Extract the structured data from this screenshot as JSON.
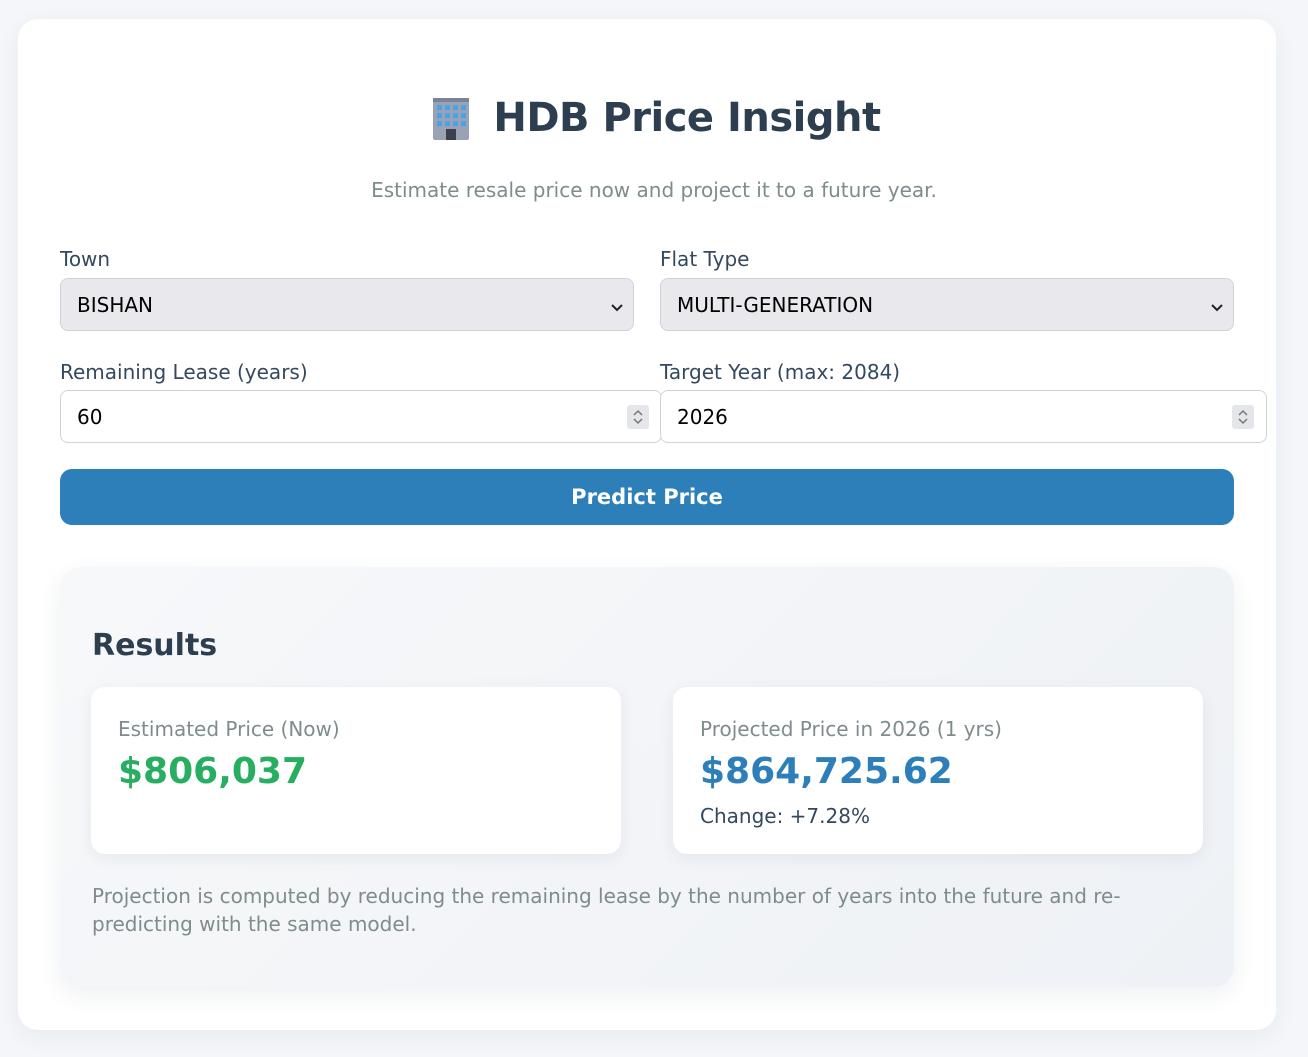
{
  "header": {
    "title": "HDB Price Insight",
    "subtitle": "Estimate resale price now and project it to a future year.",
    "icon": "office-building-icon"
  },
  "form": {
    "town": {
      "label": "Town",
      "value": "BISHAN"
    },
    "flat_type": {
      "label": "Flat Type",
      "value": "MULTI-GENERATION"
    },
    "remaining_lease": {
      "label": "Remaining Lease (years)",
      "value": "60"
    },
    "target_year": {
      "label": "Target Year (max: 2084)",
      "value": "2026"
    },
    "submit_label": "Predict Price"
  },
  "results": {
    "title": "Results",
    "estimated": {
      "label": "Estimated Price (Now)",
      "value": "$806,037",
      "color": "#27ae60"
    },
    "projected": {
      "label": "Projected Price in 2026 (1 yrs)",
      "value": "$864,725.62",
      "change": "Change: +7.28%",
      "color": "#2c7fb8"
    },
    "note": "Projection is computed by reducing the remaining lease by the number of years into the future and re-predicting with the same model."
  },
  "colors": {
    "accent": "#2c7fb8",
    "positive": "#27ae60",
    "text": "#2c3e50",
    "muted": "#7f8c8d"
  }
}
